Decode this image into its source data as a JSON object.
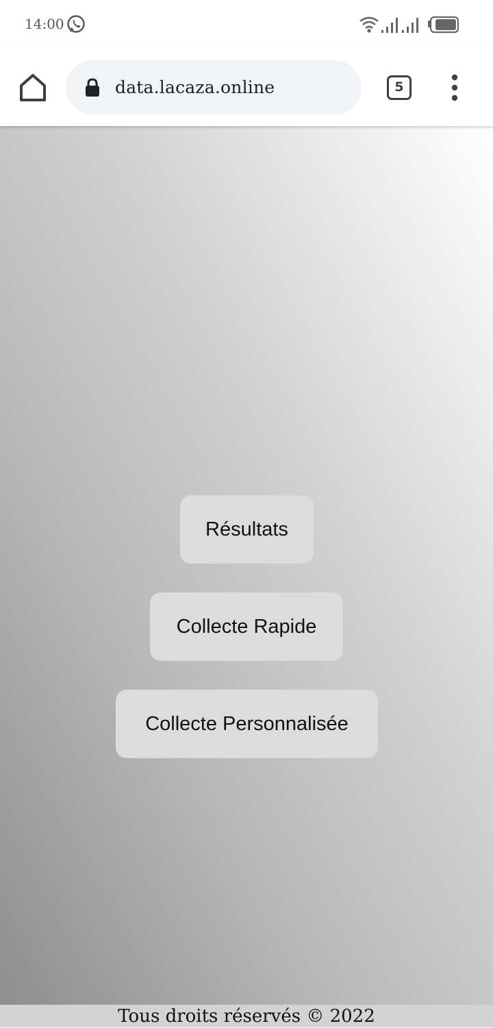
{
  "status_bar": {
    "time": "14:00",
    "notification_icon": "whatsapp-icon",
    "indicators": [
      "wifi-icon",
      "signal-icon",
      "signal-icon",
      "battery-icon"
    ]
  },
  "browser": {
    "url": "data.lacaza.online",
    "tab_count": "5",
    "icons": {
      "home": "home-icon",
      "lock": "lock-icon",
      "menu": "more-vert-icon"
    }
  },
  "main": {
    "buttons": [
      {
        "label": "Résultats"
      },
      {
        "label": "Collecte Rapide"
      },
      {
        "label": "Collecte Personnalisée"
      }
    ]
  },
  "footer": {
    "text": "Tous droits réservés © 2022"
  },
  "colors": {
    "button_background": "#dcdcdc",
    "footer_background": "#d3d3d3",
    "url_bar_background": "#f1f3f4"
  }
}
